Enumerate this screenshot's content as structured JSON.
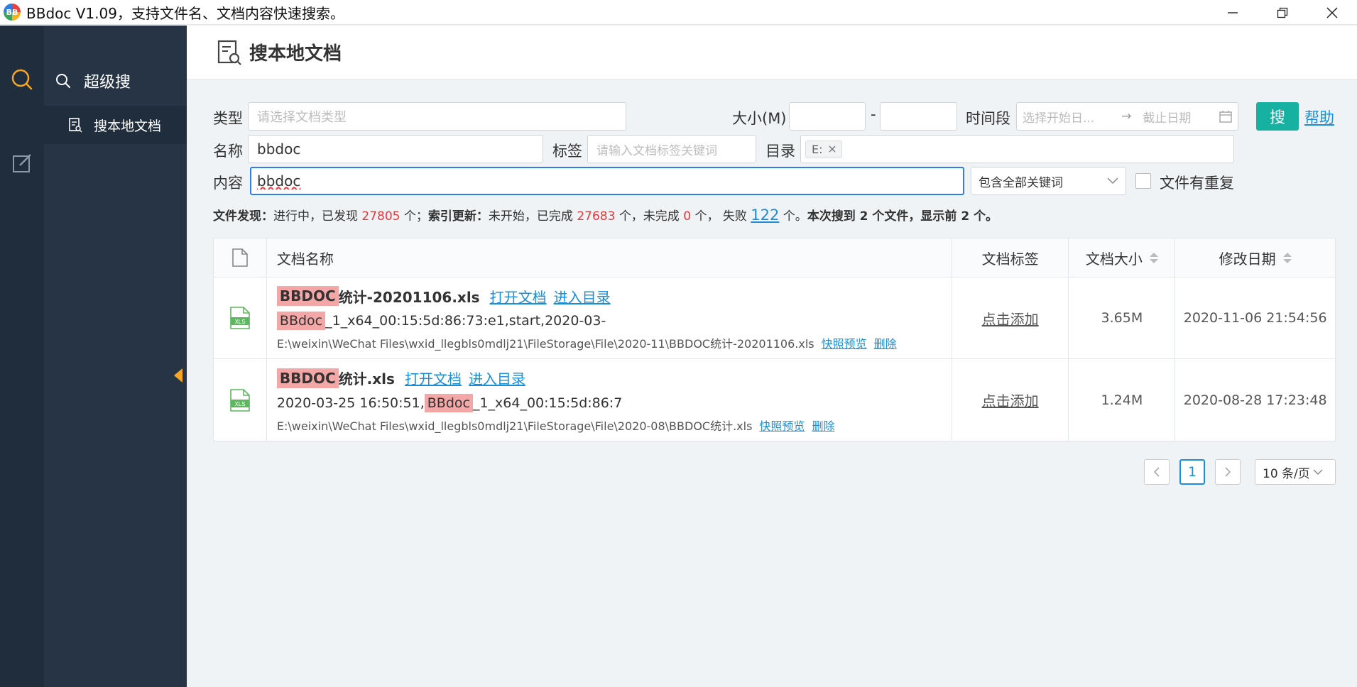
{
  "window": {
    "title": "BBdoc V1.09，支持文件名、文档内容快速搜索。",
    "logo_text": "BB"
  },
  "sidebar": {
    "section_label": "超级搜",
    "items": [
      {
        "label": "搜本地文档",
        "active": true
      }
    ]
  },
  "page": {
    "title": "搜本地文档"
  },
  "form": {
    "type_label": "类型",
    "type_placeholder": "请选择文档类型",
    "size_label": "大小(M)",
    "size_sep": "-",
    "size_min": "",
    "size_max": "",
    "time_label": "时间段",
    "date_start_placeholder": "选择开始日...",
    "date_arrow": "→",
    "date_end_placeholder": "截止日期",
    "search_button": "搜",
    "help_link": "帮助",
    "name_label": "名称",
    "name_value": "bbdoc",
    "tag_label": "标签",
    "tag_placeholder": "请输入文档标签关键词",
    "dir_label": "目录",
    "dir_chip": "E:",
    "content_label": "内容",
    "content_value": "bbdoc",
    "match_mode": "包含全部关键词",
    "dup_label": "文件有重复"
  },
  "status": {
    "discover_label": "文件发现：",
    "discover_text1": "进行中，已发现",
    "discover_count": "27805",
    "discover_unit": "个；",
    "index_label": "索引更新：",
    "index_text1": "未开始，已完成",
    "index_done": "27683",
    "index_text2": "个，未完成",
    "index_todo": "0",
    "index_text3": "个，",
    "fail_text": "失败",
    "fail_count": "122",
    "fail_unit": "个。",
    "summary": "本次搜到 2 个文件，显示前 2 个。"
  },
  "table": {
    "headers": {
      "name": "文档名称",
      "tag": "文档标签",
      "size": "文档大小",
      "date": "修改日期"
    },
    "rows": [
      {
        "file_type": "XLS",
        "name_highlight": "BBDOC",
        "name_rest": "统计-20201106.xls",
        "open_link": "打开文档",
        "dir_link": "进入目录",
        "snippet_before": "",
        "snippet_highlight": "BBdoc",
        "snippet_after": "_1_x64_00:15:5d:86:73:e1,start,2020-03-",
        "path": "E:\\weixin\\WeChat Files\\wxid_llegbls0mdlj21\\FileStorage\\File\\2020-11\\BBDOC统计-20201106.xls",
        "preview_link": "快照预览",
        "delete_link": "删除",
        "tag": "点击添加",
        "size": "3.65M",
        "date": "2020-11-06 21:54:56"
      },
      {
        "file_type": "XLS",
        "name_highlight": "BBDOC",
        "name_rest": "统计.xls",
        "open_link": "打开文档",
        "dir_link": "进入目录",
        "snippet_before": "2020-03-25 16:50:51,",
        "snippet_highlight": "BBdoc",
        "snippet_after": "_1_x64_00:15:5d:86:7",
        "path": "E:\\weixin\\WeChat Files\\wxid_llegbls0mdlj21\\FileStorage\\File\\2020-08\\BBDOC统计.xls",
        "preview_link": "快照预览",
        "delete_link": "删除",
        "tag": "点击添加",
        "size": "1.24M",
        "date": "2020-08-28 17:23:48"
      }
    ]
  },
  "pagination": {
    "current_page": "1",
    "page_size": "10 条/页"
  },
  "colors": {
    "accent": "#16b1a0",
    "link": "#1a8fd8",
    "highlight": "#f4a7a7",
    "rail": "#1f2d3d",
    "menu": "#263445"
  }
}
